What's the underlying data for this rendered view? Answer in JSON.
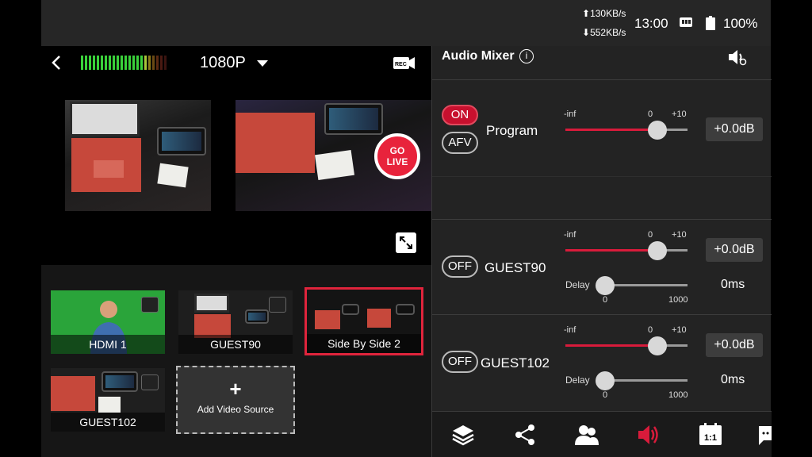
{
  "status": {
    "upload_rate": "130KB/s",
    "download_rate": "552KB/s",
    "time": "13:00",
    "battery": "100%"
  },
  "preview": {
    "resolution": "1080P",
    "go_live_line1": "GO",
    "go_live_line2": "LIVE"
  },
  "sources": {
    "items": [
      {
        "label": "HDMI 1"
      },
      {
        "label": "GUEST90"
      },
      {
        "label": "Side By Side 2"
      },
      {
        "label": "GUEST102"
      }
    ],
    "add_label": "Add Video Source",
    "add_symbol": "+"
  },
  "mixer": {
    "title": "Audio Mixer",
    "info_symbol": "i",
    "channels": [
      {
        "on_label": "ON",
        "afv_label": "AFV",
        "name": "Program",
        "min": "-inf",
        "zero": "0",
        "max": "+10",
        "gain": "+0.0dB",
        "level_pct": 75
      },
      {
        "off_label": "OFF",
        "name": "GUEST90",
        "min": "-inf",
        "zero": "0",
        "max": "+10",
        "gain": "+0.0dB",
        "level_pct": 75,
        "delay_label": "Delay",
        "delay_min": "0",
        "delay_max": "1000",
        "delay_value": "0ms",
        "delay_pct": 0
      },
      {
        "off_label": "OFF",
        "name": "GUEST102",
        "min": "-inf",
        "zero": "0",
        "max": "+10",
        "gain": "+0.0dB",
        "level_pct": 75,
        "delay_label": "Delay",
        "delay_min": "0",
        "delay_max": "1000",
        "delay_value": "0ms",
        "delay_pct": 0
      }
    ]
  },
  "tabs": [
    {
      "icon": "layers-icon"
    },
    {
      "icon": "share-icon"
    },
    {
      "icon": "guests-icon"
    },
    {
      "icon": "audio-icon",
      "active": true
    },
    {
      "icon": "ratio-icon",
      "label": "1:1"
    },
    {
      "icon": "chat-icon"
    }
  ],
  "colors": {
    "accent": "#d81b3b",
    "panel": "#232323",
    "statusbar": "#262626"
  }
}
